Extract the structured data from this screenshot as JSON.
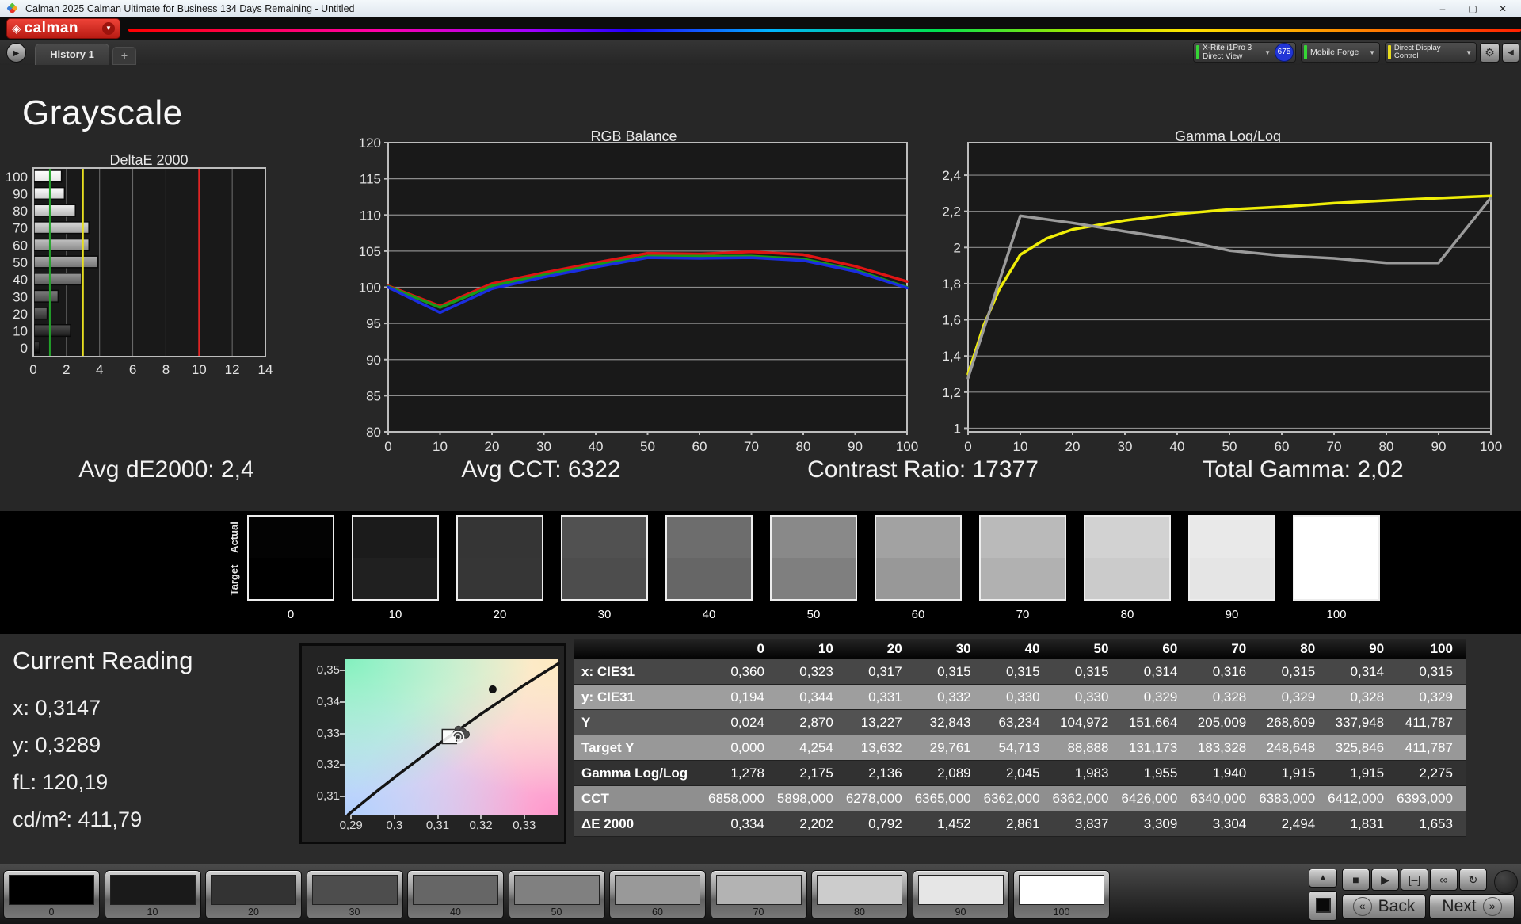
{
  "window": {
    "title": "Calman 2025 Calman Ultimate for Business 134 Days Remaining  - Untitled"
  },
  "logo": {
    "text": "calman",
    "brand_color": "#d92b21"
  },
  "tab_bar": {
    "history_tab": "History 1",
    "add_tab": "+"
  },
  "meters": {
    "meter1": {
      "line1": "X-Rite i1Pro 3",
      "line2": "Direct View",
      "badge": "675",
      "indicator_color": "#35d435",
      "badge_color": "#2135d6"
    },
    "meter2": {
      "line1": "Mobile Forge",
      "indicator_color": "#35d435"
    },
    "meter3": {
      "line1": "Direct Display Control",
      "indicator_color": "#e8dc1e"
    }
  },
  "page": {
    "title": "Grayscale"
  },
  "stats": {
    "avg_de2000": "Avg dE2000: 2,4",
    "avg_cct": "Avg CCT: 6322",
    "contrast_ratio": "Contrast Ratio: 17377",
    "total_gamma": "Total Gamma: 2,02"
  },
  "chart_data": [
    {
      "type": "bar",
      "orientation": "horizontal",
      "title": "DeltaE 2000",
      "categories": [
        "100",
        "90",
        "80",
        "70",
        "60",
        "50",
        "40",
        "30",
        "20",
        "10",
        "0"
      ],
      "values": [
        1.653,
        1.831,
        2.494,
        3.304,
        3.309,
        3.837,
        2.861,
        1.452,
        0.792,
        2.202,
        0.334
      ],
      "xlim": [
        0,
        14
      ],
      "xticks": [
        0,
        2,
        4,
        6,
        8,
        10,
        12,
        14
      ],
      "reference_lines": [
        {
          "x": 1,
          "color": "#22a32a"
        },
        {
          "x": 3,
          "color": "#e8e020"
        },
        {
          "x": 10,
          "color": "#e02424"
        }
      ]
    },
    {
      "type": "line",
      "title": "RGB Balance",
      "x": [
        0,
        10,
        20,
        30,
        40,
        50,
        60,
        70,
        80,
        90,
        100
      ],
      "xticks": [
        0,
        10,
        20,
        30,
        40,
        50,
        60,
        70,
        80,
        90,
        100
      ],
      "ylim": [
        80,
        120
      ],
      "yticks": [
        80,
        85,
        90,
        95,
        100,
        105,
        110,
        115,
        120
      ],
      "ytick_labels": [
        "80",
        "85",
        "90",
        "95",
        "100",
        "105",
        "110",
        "115",
        "120"
      ],
      "series": [
        {
          "name": "Red",
          "color": "#e01414",
          "values": [
            100.2,
            97.4,
            100.5,
            102.0,
            103.4,
            104.7,
            104.6,
            104.9,
            104.5,
            102.9,
            100.8
          ]
        },
        {
          "name": "Green",
          "color": "#189918",
          "values": [
            100.1,
            97.2,
            100.2,
            101.7,
            103.1,
            104.3,
            104.3,
            104.3,
            103.9,
            102.4,
            100.0
          ]
        },
        {
          "name": "Blue",
          "color": "#1a2ee0",
          "values": [
            100.0,
            96.5,
            99.8,
            101.4,
            102.8,
            104.1,
            104.0,
            104.1,
            103.7,
            102.2,
            99.9
          ]
        }
      ]
    },
    {
      "type": "line",
      "title": "Gamma Log/Log",
      "x": [
        0,
        10,
        20,
        30,
        40,
        50,
        60,
        70,
        80,
        90,
        100
      ],
      "xticks": [
        0,
        10,
        20,
        30,
        40,
        50,
        60,
        70,
        80,
        90,
        100
      ],
      "ylim": [
        0.98,
        2.58
      ],
      "yticks": [
        1,
        1.2,
        1.4,
        1.6,
        1.8,
        2,
        2.2,
        2.4
      ],
      "ytick_labels": [
        "1",
        "1,2",
        "1,4",
        "1,6",
        "1,8",
        "2",
        "2,2",
        "2,4"
      ],
      "series": [
        {
          "name": "Target gamma",
          "color": "#f0ee08",
          "x": [
            0,
            3,
            6,
            10,
            15,
            20,
            30,
            40,
            50,
            60,
            70,
            80,
            90,
            100
          ],
          "values": [
            1.3,
            1.57,
            1.77,
            1.96,
            2.05,
            2.1,
            2.15,
            2.185,
            2.21,
            2.225,
            2.245,
            2.26,
            2.273,
            2.285
          ]
        },
        {
          "name": "Measured gamma",
          "color": "#9b9b9b",
          "values": [
            1.278,
            2.175,
            2.136,
            2.089,
            2.045,
            1.983,
            1.955,
            1.94,
            1.915,
            1.915,
            2.275
          ]
        }
      ]
    },
    {
      "type": "scatter",
      "title": "CIE xy chromaticity",
      "xlim": [
        0.2885,
        0.3379
      ],
      "ylim": [
        0.3042,
        0.3538
      ],
      "xticks": [
        0.29,
        0.3,
        0.31,
        0.32,
        0.33
      ],
      "xtick_labels": [
        "0,29",
        "0,3",
        "0,31",
        "0,32",
        "0,33"
      ],
      "yticks": [
        0.35,
        0.34,
        0.33,
        0.32,
        0.31
      ],
      "ytick_labels": [
        "0,35",
        "0,34",
        "0,33",
        "0,32",
        "0,31"
      ],
      "locus": [
        [
          0.2893,
          0.3042
        ],
        [
          0.295,
          0.3106
        ],
        [
          0.3,
          0.316
        ],
        [
          0.305,
          0.3212
        ],
        [
          0.31,
          0.3264
        ],
        [
          0.315,
          0.3313
        ],
        [
          0.32,
          0.3362
        ],
        [
          0.325,
          0.3408
        ],
        [
          0.33,
          0.3454
        ],
        [
          0.334,
          0.3489
        ],
        [
          0.3379,
          0.3522
        ]
      ],
      "target": [
        0.3127,
        0.329
      ],
      "reading": [
        0.3147,
        0.3289
      ],
      "points": [
        [
          0.3148,
          0.3312
        ],
        [
          0.3158,
          0.3305
        ],
        [
          0.3165,
          0.3297
        ],
        [
          0.3152,
          0.3294
        ],
        [
          0.3144,
          0.33
        ]
      ],
      "outlier": [
        0.3227,
        0.344
      ]
    }
  ],
  "swatch_strip": {
    "actual_label": "Actual",
    "target_label": "Target",
    "levels": [
      "0",
      "10",
      "20",
      "30",
      "40",
      "50",
      "60",
      "70",
      "80",
      "90",
      "100"
    ],
    "actual_colors": [
      "#030303",
      "#1b1b1b",
      "#353535",
      "#515151",
      "#6d6d6d",
      "#898989",
      "#a2a2a2",
      "#bababa",
      "#d2d2d2",
      "#e9e9e9",
      "#ffffff"
    ],
    "target_colors": [
      "#000000",
      "#202020",
      "#363636",
      "#4d4d4d",
      "#666666",
      "#7f7f7f",
      "#989898",
      "#b1b1b1",
      "#cbcbcb",
      "#e5e5e5",
      "#ffffff"
    ]
  },
  "current_reading": {
    "title": "Current Reading",
    "x": "x: 0,3147",
    "y": "y: 0,3289",
    "fl": "fL: 120,19",
    "cdm2": "cd/m²: 411,79"
  },
  "table": {
    "columns": [
      "0",
      "10",
      "20",
      "30",
      "40",
      "50",
      "60",
      "70",
      "80",
      "90",
      "100"
    ],
    "rows": [
      {
        "label": "x: CIE31",
        "values": [
          "0,360",
          "0,323",
          "0,317",
          "0,315",
          "0,315",
          "0,315",
          "0,314",
          "0,316",
          "0,315",
          "0,314",
          "0,315"
        ]
      },
      {
        "label": "y: CIE31",
        "values": [
          "0,194",
          "0,344",
          "0,331",
          "0,332",
          "0,330",
          "0,330",
          "0,329",
          "0,328",
          "0,329",
          "0,328",
          "0,329"
        ]
      },
      {
        "label": "Y",
        "values": [
          "0,024",
          "2,870",
          "13,227",
          "32,843",
          "63,234",
          "104,972",
          "151,664",
          "205,009",
          "268,609",
          "337,948",
          "411,787"
        ]
      },
      {
        "label": "Target Y",
        "values": [
          "0,000",
          "4,254",
          "13,632",
          "29,761",
          "54,713",
          "88,888",
          "131,173",
          "183,328",
          "248,648",
          "325,846",
          "411,787"
        ]
      },
      {
        "label": "Gamma Log/Log",
        "values": [
          "1,278",
          "2,175",
          "2,136",
          "2,089",
          "2,045",
          "1,983",
          "1,955",
          "1,940",
          "1,915",
          "1,915",
          "2,275"
        ]
      },
      {
        "label": "CCT",
        "values": [
          "6858,000",
          "5898,000",
          "6278,000",
          "6365,000",
          "6362,000",
          "6362,000",
          "6426,000",
          "6340,000",
          "6383,000",
          "6412,000",
          "6393,000"
        ]
      },
      {
        "label": "ΔE 2000",
        "values": [
          "0,334",
          "2,202",
          "0,792",
          "1,452",
          "2,861",
          "3,837",
          "3,309",
          "3,304",
          "2,494",
          "1,831",
          "1,653"
        ]
      }
    ]
  },
  "toolbar": {
    "levels": [
      "0",
      "10",
      "20",
      "30",
      "40",
      "50",
      "60",
      "70",
      "80",
      "90",
      "100"
    ],
    "colors": [
      "#000000",
      "#1a1a1a",
      "#333333",
      "#4d4d4d",
      "#666666",
      "#808080",
      "#999999",
      "#b3b3b3",
      "#cccccc",
      "#e6e6e6",
      "#ffffff"
    ],
    "back_label": "Back",
    "next_label": "Next",
    "back_chevron": "«",
    "next_chevron": "»",
    "transport_icons": [
      "stop",
      "play",
      "interval",
      "loop",
      "refresh"
    ]
  }
}
